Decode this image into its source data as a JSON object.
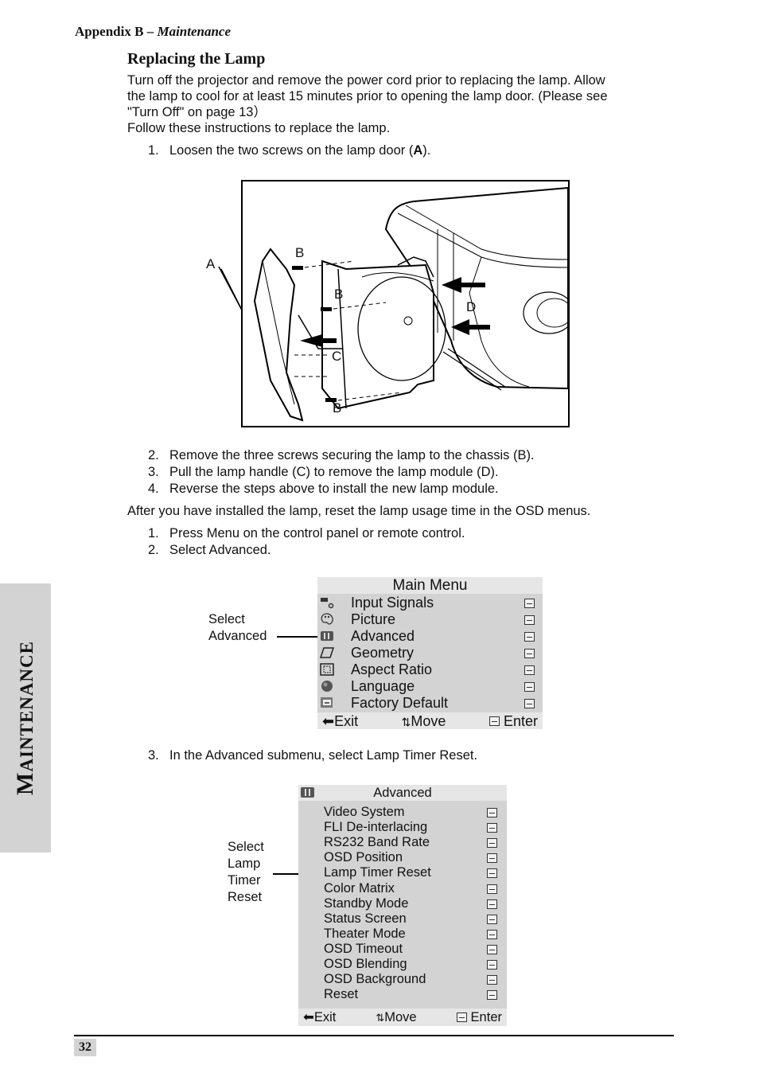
{
  "header": {
    "appendix": "Appendix B –",
    "section": "Maintenance"
  },
  "title": "Replacing the Lamp",
  "intro": {
    "line1": "Turn off the projector and remove the power cord prior to replacing the lamp. Allow",
    "line2": "the lamp to cool for at least 15 minutes prior to opening the lamp door. (Please see",
    "line3": "\"Turn Off\" on page 13）",
    "line4": "Follow these instructions to replace the lamp."
  },
  "steps_a": [
    {
      "num": "1.",
      "text_pre": "Loosen the two screws on the lamp door (",
      "bold": "A",
      "text_post": ")."
    }
  ],
  "figure": {
    "labels": {
      "a": "A",
      "b1": "B",
      "b2": "B",
      "b3": "B",
      "c": "C",
      "d": "D"
    }
  },
  "steps_b": [
    {
      "num": "2.",
      "text": "Remove the three screws securing the lamp to the chassis (B)."
    },
    {
      "num": "3.",
      "text": "Pull the lamp handle (C) to remove the lamp module (D)."
    },
    {
      "num": "4.",
      "text": "Reverse the steps above to install the new lamp module."
    }
  ],
  "after_text": "After you have installed the lamp, reset the lamp usage time in the OSD menus.",
  "steps_c": [
    {
      "num": "1.",
      "text": "Press Menu on the control panel or remote control."
    },
    {
      "num": "2.",
      "text": "Select Advanced."
    }
  ],
  "main_menu": {
    "title": "Main Menu",
    "callout": [
      "Select",
      "Advanced"
    ],
    "items": [
      {
        "label": "Input  Signals",
        "icon": "input-signals-icon"
      },
      {
        "label": "Picture",
        "icon": "palette-icon"
      },
      {
        "label": "Advanced",
        "icon": "advanced-icon"
      },
      {
        "label": "Geometry",
        "icon": "parallelogram-icon"
      },
      {
        "label": "Aspect Ratio",
        "icon": "aspect-ratio-icon"
      },
      {
        "label": "Language",
        "icon": "globe-icon"
      },
      {
        "label": "Factory Default",
        "icon": "factory-default-icon"
      }
    ],
    "footer": {
      "exit": "Exit",
      "move": "Move",
      "enter": "Enter"
    }
  },
  "step_d": {
    "num": "3.",
    "text": "In the Advanced submenu, select Lamp Timer Reset."
  },
  "advanced_menu": {
    "title": "Advanced",
    "callout": [
      "Select",
      "Lamp",
      "Timer",
      "Reset"
    ],
    "items": [
      "Video System",
      "FLI De-interlacing",
      "RS232 Band Rate",
      "OSD Position",
      "Lamp Timer Reset",
      "Color Matrix",
      "Standby Mode",
      "Status Screen",
      "Theater Mode",
      "OSD Timeout",
      "OSD Blending",
      "OSD Background",
      "Reset"
    ],
    "footer": {
      "exit": "Exit",
      "move": "Move",
      "enter": "Enter"
    }
  },
  "side_tab": {
    "first": "M",
    "rest": "AINTENANCE"
  },
  "page_number": "32"
}
